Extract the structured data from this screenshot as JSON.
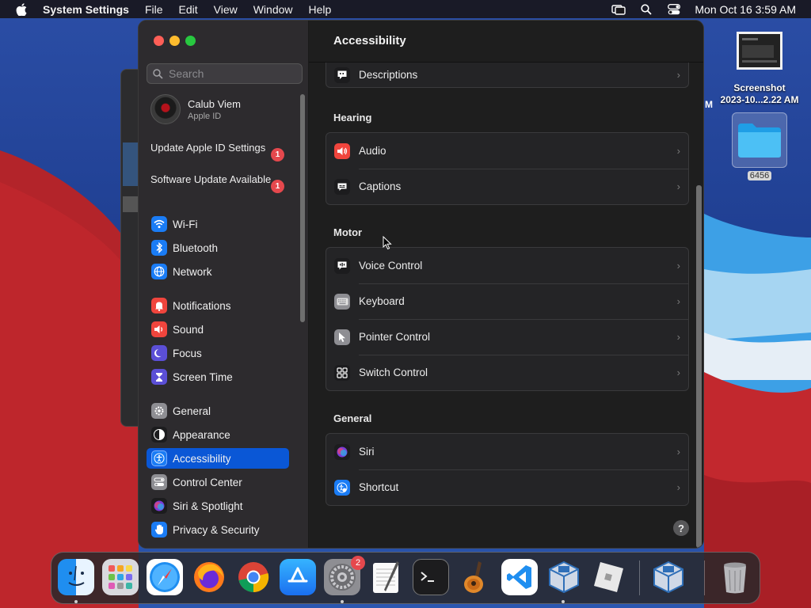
{
  "menubar": {
    "app_name": "System Settings",
    "menus": [
      "File",
      "Edit",
      "View",
      "Window",
      "Help"
    ],
    "clock": "Mon Oct 16  3:59 AM",
    "icons": [
      "apple-icon",
      "screen-mirroring-icon",
      "spotlight-search-icon",
      "control-center-icon"
    ]
  },
  "sidebar": {
    "search_placeholder": "Search",
    "profile": {
      "name": "Calub Viem",
      "subtitle": "Apple ID"
    },
    "notices": [
      {
        "label": "Update Apple ID Settings",
        "badge": "1"
      },
      {
        "label": "Software Update Available",
        "badge": "1"
      }
    ],
    "items": [
      {
        "label": "Wi-Fi",
        "icon": "wifi-icon",
        "color": "#1a7cf5"
      },
      {
        "label": "Bluetooth",
        "icon": "bluetooth-icon",
        "color": "#1a7cf5"
      },
      {
        "label": "Network",
        "icon": "globe-icon",
        "color": "#1a7cf5"
      },
      {
        "label": "Notifications",
        "icon": "bell-icon",
        "color": "#f0453d"
      },
      {
        "label": "Sound",
        "icon": "speaker-icon",
        "color": "#f0453d"
      },
      {
        "label": "Focus",
        "icon": "moon-icon",
        "color": "#5b4fd6"
      },
      {
        "label": "Screen Time",
        "icon": "hourglass-icon",
        "color": "#5b4fd6"
      },
      {
        "label": "General",
        "icon": "gear-icon",
        "color": "#8e8e93"
      },
      {
        "label": "Appearance",
        "icon": "appearance-icon",
        "color": "#1c1c1e"
      },
      {
        "label": "Accessibility",
        "icon": "accessibility-icon",
        "color": "#1a7cf5",
        "selected": true
      },
      {
        "label": "Control Center",
        "icon": "control-center-icon",
        "color": "#8e8e93"
      },
      {
        "label": "Siri & Spotlight",
        "icon": "siri-icon",
        "color": "#1c1c1e"
      },
      {
        "label": "Privacy & Security",
        "icon": "hand-icon",
        "color": "#1a7cf5"
      }
    ]
  },
  "content": {
    "title": "Accessibility",
    "partial_row": {
      "label": "Descriptions",
      "icon": "descriptions-icon"
    },
    "sections": [
      {
        "heading": "Hearing",
        "rows": [
          {
            "label": "Audio",
            "icon": "audio-icon",
            "color": "#f0453d"
          },
          {
            "label": "Captions",
            "icon": "captions-icon",
            "color": "#1c1c1e"
          }
        ]
      },
      {
        "heading": "Motor",
        "rows": [
          {
            "label": "Voice Control",
            "icon": "voice-control-icon",
            "color": "#1c1c1e"
          },
          {
            "label": "Keyboard",
            "icon": "keyboard-icon",
            "color": "#8e8e93"
          },
          {
            "label": "Pointer Control",
            "icon": "pointer-icon",
            "color": "#8e8e93"
          },
          {
            "label": "Switch Control",
            "icon": "switch-control-icon",
            "color": "#1c1c1e"
          }
        ]
      },
      {
        "heading": "General",
        "rows": [
          {
            "label": "Siri",
            "icon": "siri-icon",
            "color": "#1c1c1e"
          },
          {
            "label": "Shortcut",
            "icon": "shortcut-icon",
            "color": "#1a7cf5"
          }
        ]
      }
    ],
    "help": "?"
  },
  "desktop": {
    "screenshot_label_line1": "Screenshot",
    "screenshot_label_line2": "2023-10...2.22 AM",
    "folder_label": "6456",
    "edge_text": "M"
  },
  "dock": {
    "apps": [
      "Finder",
      "Launchpad",
      "Safari",
      "Firefox",
      "Chrome",
      "App Store",
      "System Settings",
      "TextEdit",
      "Terminal",
      "GarageBand",
      "Visual Studio Code",
      "VirtualBox",
      "Roblox",
      "VirtualBox VM",
      "Trash"
    ],
    "settings_badge": "2"
  }
}
